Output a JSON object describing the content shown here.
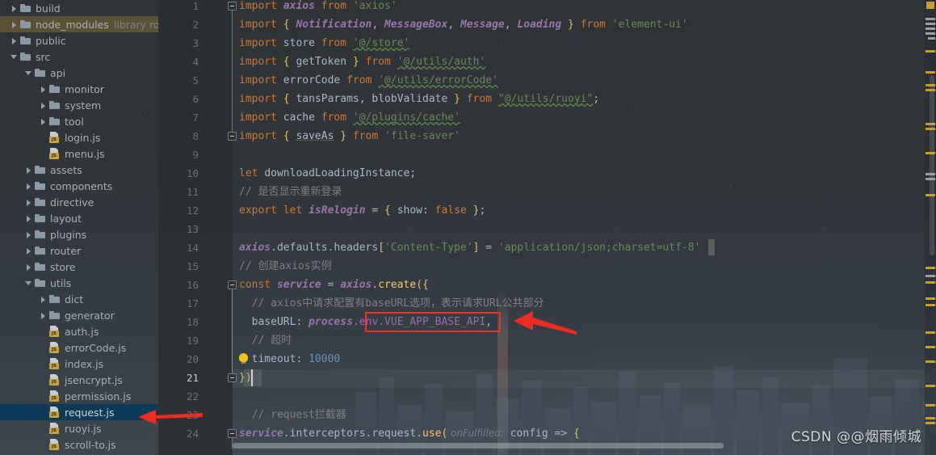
{
  "window": {
    "watermark": "CSDN @@烟雨倾城"
  },
  "project_tree": {
    "name": "project-file-tree",
    "items": [
      {
        "label": "build",
        "indent": 1,
        "type": "folder",
        "state": "closed",
        "highlight": "none"
      },
      {
        "label": "node_modules",
        "indent": 1,
        "type": "folder",
        "state": "closed",
        "highlight": "olive",
        "suffix": "library root"
      },
      {
        "label": "public",
        "indent": 1,
        "type": "folder",
        "state": "closed",
        "highlight": "none"
      },
      {
        "label": "src",
        "indent": 1,
        "type": "folder",
        "state": "open",
        "highlight": "none"
      },
      {
        "label": "api",
        "indent": 2,
        "type": "folder",
        "state": "open",
        "highlight": "none"
      },
      {
        "label": "monitor",
        "indent": 3,
        "type": "folder",
        "state": "closed",
        "highlight": "none"
      },
      {
        "label": "system",
        "indent": 3,
        "type": "folder",
        "state": "closed",
        "highlight": "none"
      },
      {
        "label": "tool",
        "indent": 3,
        "type": "folder",
        "state": "closed",
        "highlight": "none"
      },
      {
        "label": "login.js",
        "indent": 3,
        "type": "js",
        "state": "none",
        "highlight": "none"
      },
      {
        "label": "menu.js",
        "indent": 3,
        "type": "js",
        "state": "none",
        "highlight": "none"
      },
      {
        "label": "assets",
        "indent": 2,
        "type": "folder",
        "state": "closed",
        "highlight": "none"
      },
      {
        "label": "components",
        "indent": 2,
        "type": "folder",
        "state": "closed",
        "highlight": "none"
      },
      {
        "label": "directive",
        "indent": 2,
        "type": "folder",
        "state": "closed",
        "highlight": "none"
      },
      {
        "label": "layout",
        "indent": 2,
        "type": "folder",
        "state": "closed",
        "highlight": "none"
      },
      {
        "label": "plugins",
        "indent": 2,
        "type": "folder",
        "state": "closed",
        "highlight": "none"
      },
      {
        "label": "router",
        "indent": 2,
        "type": "folder",
        "state": "closed",
        "highlight": "none"
      },
      {
        "label": "store",
        "indent": 2,
        "type": "folder",
        "state": "closed",
        "highlight": "none"
      },
      {
        "label": "utils",
        "indent": 2,
        "type": "folder",
        "state": "open",
        "highlight": "none"
      },
      {
        "label": "dict",
        "indent": 3,
        "type": "folder",
        "state": "closed",
        "highlight": "none"
      },
      {
        "label": "generator",
        "indent": 3,
        "type": "folder",
        "state": "closed",
        "highlight": "none"
      },
      {
        "label": "auth.js",
        "indent": 3,
        "type": "js",
        "state": "none",
        "highlight": "none"
      },
      {
        "label": "errorCode.js",
        "indent": 3,
        "type": "js",
        "state": "none",
        "highlight": "none"
      },
      {
        "label": "index.js",
        "indent": 3,
        "type": "js",
        "state": "none",
        "highlight": "none"
      },
      {
        "label": "jsencrypt.js",
        "indent": 3,
        "type": "js",
        "state": "none",
        "highlight": "none"
      },
      {
        "label": "permission.js",
        "indent": 3,
        "type": "js",
        "state": "none",
        "highlight": "none"
      },
      {
        "label": "request.js",
        "indent": 3,
        "type": "js",
        "state": "none",
        "highlight": "blue"
      },
      {
        "label": "ruoyi.js",
        "indent": 3,
        "type": "js",
        "state": "none",
        "highlight": "none"
      },
      {
        "label": "scroll-to.js",
        "indent": 3,
        "type": "js",
        "state": "none",
        "highlight": "none"
      }
    ]
  },
  "editor": {
    "current_line": 21,
    "line_numbers": [
      1,
      2,
      3,
      4,
      5,
      6,
      7,
      8,
      9,
      10,
      11,
      12,
      13,
      14,
      15,
      16,
      17,
      18,
      19,
      20,
      21,
      22,
      23,
      24
    ],
    "lines": [
      {
        "n": 1,
        "text": "import axios from 'axios'"
      },
      {
        "n": 2,
        "text": "import { Notification, MessageBox, Message, Loading } from 'element-ui'"
      },
      {
        "n": 3,
        "text": "import store from '@/store'"
      },
      {
        "n": 4,
        "text": "import { getToken } from '@/utils/auth'"
      },
      {
        "n": 5,
        "text": "import errorCode from '@/utils/errorCode'"
      },
      {
        "n": 6,
        "text": "import { tansParams, blobValidate } from \"@/utils/ruoyi\";"
      },
      {
        "n": 7,
        "text": "import cache from '@/plugins/cache'"
      },
      {
        "n": 8,
        "text": "import { saveAs } from 'file-saver'"
      },
      {
        "n": 9,
        "text": ""
      },
      {
        "n": 10,
        "text": "let downloadLoadingInstance;"
      },
      {
        "n": 11,
        "text": "// 是否显示重新登录"
      },
      {
        "n": 12,
        "text": "export let isRelogin = { show: false };"
      },
      {
        "n": 13,
        "text": ""
      },
      {
        "n": 14,
        "text": "axios.defaults.headers['Content-Type'] = 'application/json;charset=utf-8'"
      },
      {
        "n": 15,
        "text": "// 创建axios实例"
      },
      {
        "n": 16,
        "text": "const service = axios.create({"
      },
      {
        "n": 17,
        "text": "  // axios中请求配置有baseURL选项，表示请求URL公共部分"
      },
      {
        "n": 18,
        "text": "  baseURL: process.env.VUE_APP_BASE_API,"
      },
      {
        "n": 19,
        "text": "  // 超时"
      },
      {
        "n": 20,
        "text": "  timeout: 10000"
      },
      {
        "n": 21,
        "text": "})"
      },
      {
        "n": 22,
        "text": ""
      },
      {
        "n": 23,
        "text": "  // request拦截器"
      },
      {
        "n": 24,
        "text": "service.interceptors.request.use( onFulfilled: config => {"
      }
    ],
    "tokens": {
      "l1": [
        [
          "kw",
          "import"
        ],
        [
          "sp",
          " "
        ],
        [
          "cls",
          "axios"
        ],
        [
          "sp",
          " "
        ],
        [
          "kw",
          "from"
        ],
        [
          "sp",
          " "
        ],
        [
          "str",
          "'axios'"
        ]
      ],
      "l2": [
        [
          "kw",
          "import"
        ],
        [
          "sp",
          " "
        ],
        [
          "br",
          "{"
        ],
        [
          "sp",
          " "
        ],
        [
          "cls",
          "Notification"
        ],
        [
          "op",
          ","
        ],
        [
          "sp",
          " "
        ],
        [
          "cls",
          "MessageBox"
        ],
        [
          "op",
          ","
        ],
        [
          "sp",
          " "
        ],
        [
          "cls",
          "Message"
        ],
        [
          "op",
          ","
        ],
        [
          "sp",
          " "
        ],
        [
          "cls",
          "Loading"
        ],
        [
          "sp",
          " "
        ],
        [
          "br",
          "}"
        ],
        [
          "sp",
          " "
        ],
        [
          "kw",
          "from"
        ],
        [
          "sp",
          " "
        ],
        [
          "str",
          "'element-ui'"
        ]
      ],
      "l3": [
        [
          "kw",
          "import"
        ],
        [
          "sp",
          " "
        ],
        [
          "id",
          "store"
        ],
        [
          "sp",
          " "
        ],
        [
          "kw",
          "from"
        ],
        [
          "sp",
          " "
        ],
        [
          "str-sq",
          "'@/store'"
        ]
      ],
      "l4": [
        [
          "kw",
          "import"
        ],
        [
          "sp",
          " "
        ],
        [
          "br",
          "{"
        ],
        [
          "sp",
          " "
        ],
        [
          "id",
          "getToken"
        ],
        [
          "sp",
          " "
        ],
        [
          "br",
          "}"
        ],
        [
          "sp",
          " "
        ],
        [
          "kw",
          "from"
        ],
        [
          "sp",
          " "
        ],
        [
          "str-sq",
          "'@/utils/auth'"
        ]
      ],
      "l5": [
        [
          "kw",
          "import"
        ],
        [
          "sp",
          " "
        ],
        [
          "id",
          "errorCode"
        ],
        [
          "sp",
          " "
        ],
        [
          "kw",
          "from"
        ],
        [
          "sp",
          " "
        ],
        [
          "str-sq",
          "'@/utils/errorCode'"
        ]
      ],
      "l6": [
        [
          "kw",
          "import"
        ],
        [
          "sp",
          " "
        ],
        [
          "br",
          "{"
        ],
        [
          "sp",
          " "
        ],
        [
          "id",
          "tansParams"
        ],
        [
          "op",
          ","
        ],
        [
          "sp",
          " "
        ],
        [
          "id",
          "blobValidate"
        ],
        [
          "sp",
          " "
        ],
        [
          "br",
          "}"
        ],
        [
          "sp",
          " "
        ],
        [
          "kw",
          "from"
        ],
        [
          "sp",
          " "
        ],
        [
          "str-sq",
          "\"@/utils/ruoyi\""
        ],
        [
          "op",
          ";"
        ]
      ],
      "l7": [
        [
          "kw",
          "import"
        ],
        [
          "sp",
          " "
        ],
        [
          "id",
          "cache"
        ],
        [
          "sp",
          " "
        ],
        [
          "kw",
          "from"
        ],
        [
          "sp",
          " "
        ],
        [
          "str-sq",
          "'@/plugins/cache'"
        ]
      ],
      "l8": [
        [
          "kw",
          "import"
        ],
        [
          "sp",
          " "
        ],
        [
          "br",
          "{"
        ],
        [
          "sp",
          " "
        ],
        [
          "id-u",
          "saveAs"
        ],
        [
          "sp",
          " "
        ],
        [
          "br",
          "}"
        ],
        [
          "sp",
          " "
        ],
        [
          "kw",
          "from"
        ],
        [
          "sp",
          " "
        ],
        [
          "str",
          "'file-saver'"
        ]
      ],
      "l10": [
        [
          "kw",
          "let"
        ],
        [
          "sp",
          " "
        ],
        [
          "id",
          "downloadLoadingInstance"
        ],
        [
          "op",
          ";"
        ]
      ],
      "l11": [
        [
          "cmt",
          "// 是否显示重新登录"
        ]
      ],
      "l12": [
        [
          "kw",
          "export"
        ],
        [
          "sp",
          " "
        ],
        [
          "kw",
          "let"
        ],
        [
          "sp",
          " "
        ],
        [
          "cls",
          "isRelogin"
        ],
        [
          "sp",
          " "
        ],
        [
          "op",
          "="
        ],
        [
          "sp",
          " "
        ],
        [
          "br",
          "{"
        ],
        [
          "sp",
          " "
        ],
        [
          "id",
          "show"
        ],
        [
          "op",
          ":"
        ],
        [
          "sp",
          " "
        ],
        [
          "kw",
          "false"
        ],
        [
          "sp",
          " "
        ],
        [
          "br",
          "}"
        ],
        [
          "op",
          ";"
        ]
      ],
      "l14": [
        [
          "cls",
          "axios"
        ],
        [
          "op",
          "."
        ],
        [
          "id",
          "defaults"
        ],
        [
          "op",
          "."
        ],
        [
          "id",
          "headers"
        ],
        [
          "br",
          "["
        ],
        [
          "str",
          "'Content-Type'"
        ],
        [
          "br",
          "]"
        ],
        [
          "sp",
          " "
        ],
        [
          "op",
          "="
        ],
        [
          "sp",
          " "
        ],
        [
          "str",
          "'application/json;charset=utf-8'"
        ]
      ],
      "l15": [
        [
          "cmt",
          "// 创建axios实例"
        ]
      ],
      "l16": [
        [
          "kw",
          "const"
        ],
        [
          "sp",
          " "
        ],
        [
          "cls",
          "service"
        ],
        [
          "sp",
          " "
        ],
        [
          "op",
          "="
        ],
        [
          "sp",
          " "
        ],
        [
          "cls",
          "axios"
        ],
        [
          "op",
          "."
        ],
        [
          "fn",
          "create"
        ],
        [
          "br",
          "({"
        ]
      ],
      "l17": [
        [
          "cmt",
          "  // axios中请求配置有baseURL选项，表示请求URL公共部分"
        ]
      ],
      "l18": [
        [
          "id",
          "  baseURL"
        ],
        [
          "op",
          ":"
        ],
        [
          "sp",
          " "
        ],
        [
          "cls",
          "process"
        ],
        [
          "field",
          ".env.VUE_APP_BASE_API"
        ],
        [
          "op",
          ","
        ]
      ],
      "l19": [
        [
          "cmt",
          "  // 超时"
        ]
      ],
      "l20": [
        [
          "id",
          "  timeout"
        ],
        [
          "op",
          ":"
        ],
        [
          "sp",
          " "
        ],
        [
          "num",
          "10000"
        ]
      ],
      "l21": [
        [
          "br",
          "})"
        ]
      ],
      "l23": [
        [
          "cmt",
          "  // request拦截器"
        ]
      ],
      "l24": [
        [
          "cls",
          "service"
        ],
        [
          "op",
          ".interceptors.request."
        ],
        [
          "fn",
          "use"
        ],
        [
          "br",
          "("
        ],
        [
          "hint",
          " onFulfilled:"
        ],
        [
          "sp",
          " "
        ],
        [
          "id",
          "config"
        ],
        [
          "sp",
          " "
        ],
        [
          "op",
          "=>"
        ],
        [
          "sp",
          " "
        ],
        [
          "br",
          "{"
        ]
      ]
    }
  },
  "annotations": {
    "red_box_target": "process.env.VUE_APP_BASE_API",
    "arrow_1": "points-at-baseURL-value",
    "arrow_2": "points-at-request-js-file"
  },
  "colors": {
    "keyword": "#cc7832",
    "class": "#9876aa",
    "string": "#6a8759",
    "identifier": "#a9b7c6",
    "function": "#ffc66d",
    "number": "#6897bb",
    "comment": "#808080",
    "bracket": "#d9c36a",
    "annotation_red": "#e8342a",
    "selection_blue": "#0d3a58",
    "marker_warn": "#c6a02a"
  }
}
